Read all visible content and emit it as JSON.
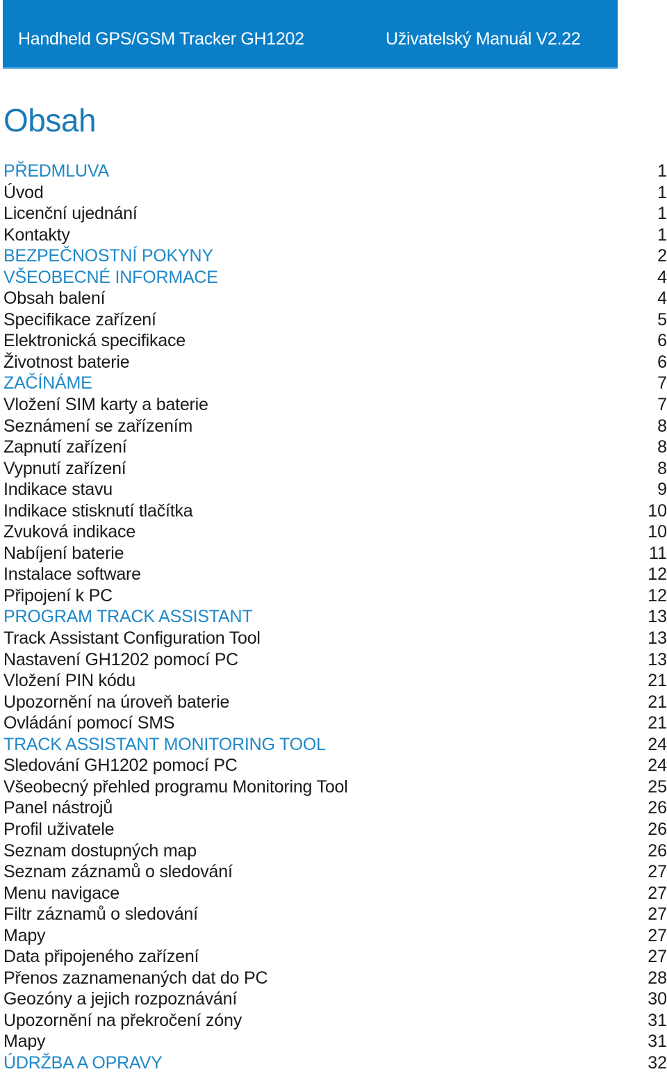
{
  "header": {
    "left": "Handheld GPS/GSM Tracker GH1202",
    "right": "Uživatelský Manuál V2.22",
    "color": "#0a7fc8"
  },
  "title": "Obsah",
  "accent_color": "#1e88c8",
  "toc": [
    {
      "label": "PŘEDMLUVA",
      "page": "1",
      "section": true
    },
    {
      "label": "Úvod",
      "page": "1",
      "section": false
    },
    {
      "label": "Licenční ujednání",
      "page": "1",
      "section": false
    },
    {
      "label": "Kontakty",
      "page": "1",
      "section": false
    },
    {
      "label": "BEZPEČNOSTNÍ POKYNY",
      "page": "2",
      "section": true
    },
    {
      "label": "VŠEOBECNÉ INFORMACE",
      "page": "4",
      "section": true
    },
    {
      "label": "Obsah balení",
      "page": "4",
      "section": false
    },
    {
      "label": "Specifikace zařízení",
      "page": "5",
      "section": false
    },
    {
      "label": "Elektronická specifikace",
      "page": "6",
      "section": false
    },
    {
      "label": "Životnost baterie",
      "page": "6",
      "section": false
    },
    {
      "label": "ZAČÍNÁME",
      "page": "7",
      "section": true
    },
    {
      "label": "Vložení SIM karty a baterie",
      "page": "7",
      "section": false
    },
    {
      "label": "Seznámení se zařízením",
      "page": "8",
      "section": false
    },
    {
      "label": "Zapnutí zařízení",
      "page": "8",
      "section": false
    },
    {
      "label": "Vypnutí zařízení",
      "page": "8",
      "section": false
    },
    {
      "label": "Indikace stavu",
      "page": "9",
      "section": false
    },
    {
      "label": "Indikace stisknutí tlačítka",
      "page": "10",
      "section": false
    },
    {
      "label": "Zvuková indikace",
      "page": "10",
      "section": false
    },
    {
      "label": "Nabíjení baterie",
      "page": "11",
      "section": false
    },
    {
      "label": "Instalace software",
      "page": "12",
      "section": false
    },
    {
      "label": "Připojení k PC",
      "page": "12",
      "section": false
    },
    {
      "label": "PROGRAM TRACK ASSISTANT",
      "page": "13",
      "section": true
    },
    {
      "label": "Track Assistant Configuration Tool",
      "page": "13",
      "section": false
    },
    {
      "label": "Nastavení GH1202 pomocí PC",
      "page": "13",
      "section": false
    },
    {
      "label": "Vložení PIN kódu",
      "page": "21",
      "section": false
    },
    {
      "label": "Upozornění na úroveň baterie",
      "page": "21",
      "section": false
    },
    {
      "label": "Ovládání pomocí SMS",
      "page": "21",
      "section": false
    },
    {
      "label": "TRACK ASSISTANT MONITORING TOOL",
      "page": "24",
      "section": true
    },
    {
      "label": "Sledování GH1202 pomocí PC",
      "page": "24",
      "section": false
    },
    {
      "label": "Všeobecný přehled programu Monitoring Tool",
      "page": "25",
      "section": false
    },
    {
      "label": "Panel nástrojů",
      "page": "26",
      "section": false
    },
    {
      "label": "Profil uživatele",
      "page": "26",
      "section": false
    },
    {
      "label": "Seznam dostupných map",
      "page": "26",
      "section": false
    },
    {
      "label": "Seznam záznamů o sledování",
      "page": "27",
      "section": false
    },
    {
      "label": "Menu navigace",
      "page": "27",
      "section": false
    },
    {
      "label": "Filtr záznamů o sledování",
      "page": "27",
      "section": false
    },
    {
      "label": "Mapy",
      "page": "27",
      "section": false
    },
    {
      "label": "Data připojeného zařízení",
      "page": "27",
      "section": false
    },
    {
      "label": "Přenos zaznamenaných dat do PC",
      "page": "28",
      "section": false
    },
    {
      "label": "Geozóny a jejich rozpoznávání",
      "page": "30",
      "section": false
    },
    {
      "label": "Upozornění na překročení zóny",
      "page": "31",
      "section": false
    },
    {
      "label": "Mapy",
      "page": "31",
      "section": false
    },
    {
      "label": "ÚDRŽBA A OPRAVY",
      "page": "32",
      "section": true
    }
  ]
}
